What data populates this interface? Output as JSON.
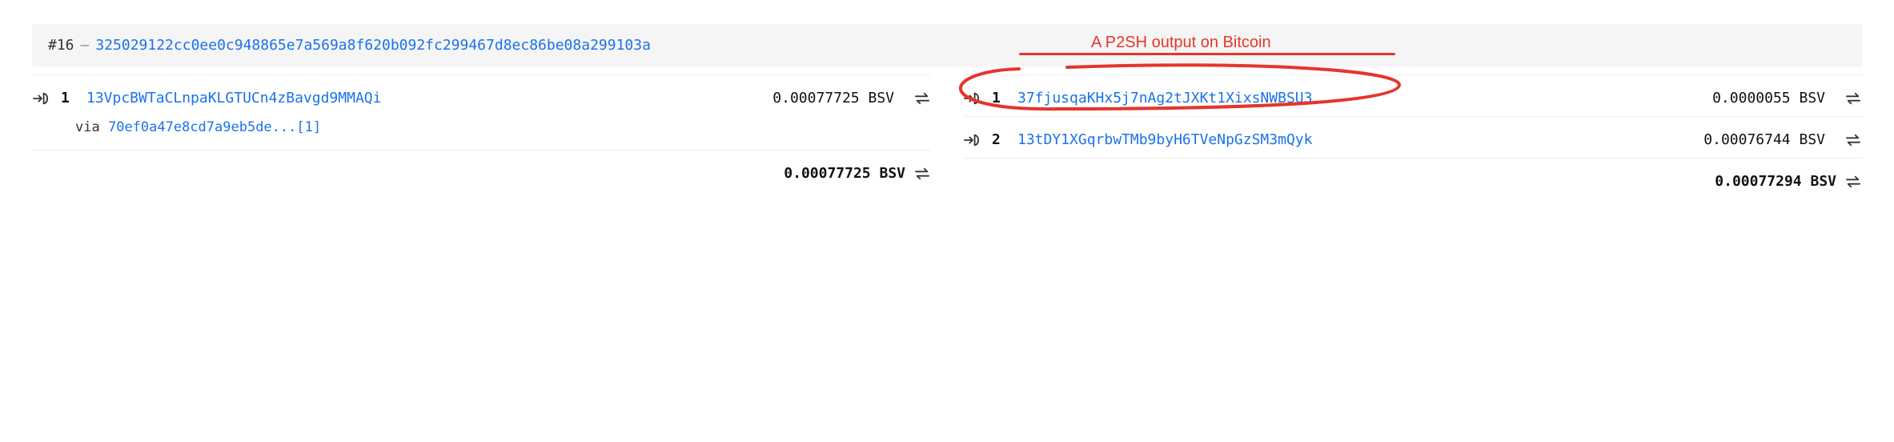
{
  "header": {
    "index_label": "#16",
    "dash": "–",
    "txid": "325029122cc0ee0c948865e7a569a8f620b092fc299467d8ec86be08a299103a"
  },
  "via": {
    "prefix": "via",
    "link": "70ef0a47e8cd7a9eb5de...[1]"
  },
  "annotation": {
    "label": "A P2SH output on Bitcoin"
  },
  "currency": "BSV",
  "inputs": [
    {
      "n": "1",
      "address": "13VpcBWTaCLnpaKLGTUCn4zBavgd9MMAQi",
      "amount": "0.00077725"
    }
  ],
  "outputs": [
    {
      "n": "1",
      "address": "37fjusqaKHx5j7nAg2tJXKt1XixsNWBSU3",
      "amount": "0.0000055"
    },
    {
      "n": "2",
      "address": "13tDY1XGqrbwTMb9byH6TVeNpGzSM3mQyk",
      "amount": "0.00076744"
    }
  ],
  "totals": {
    "inputs": "0.00077725",
    "outputs": "0.00077294"
  }
}
